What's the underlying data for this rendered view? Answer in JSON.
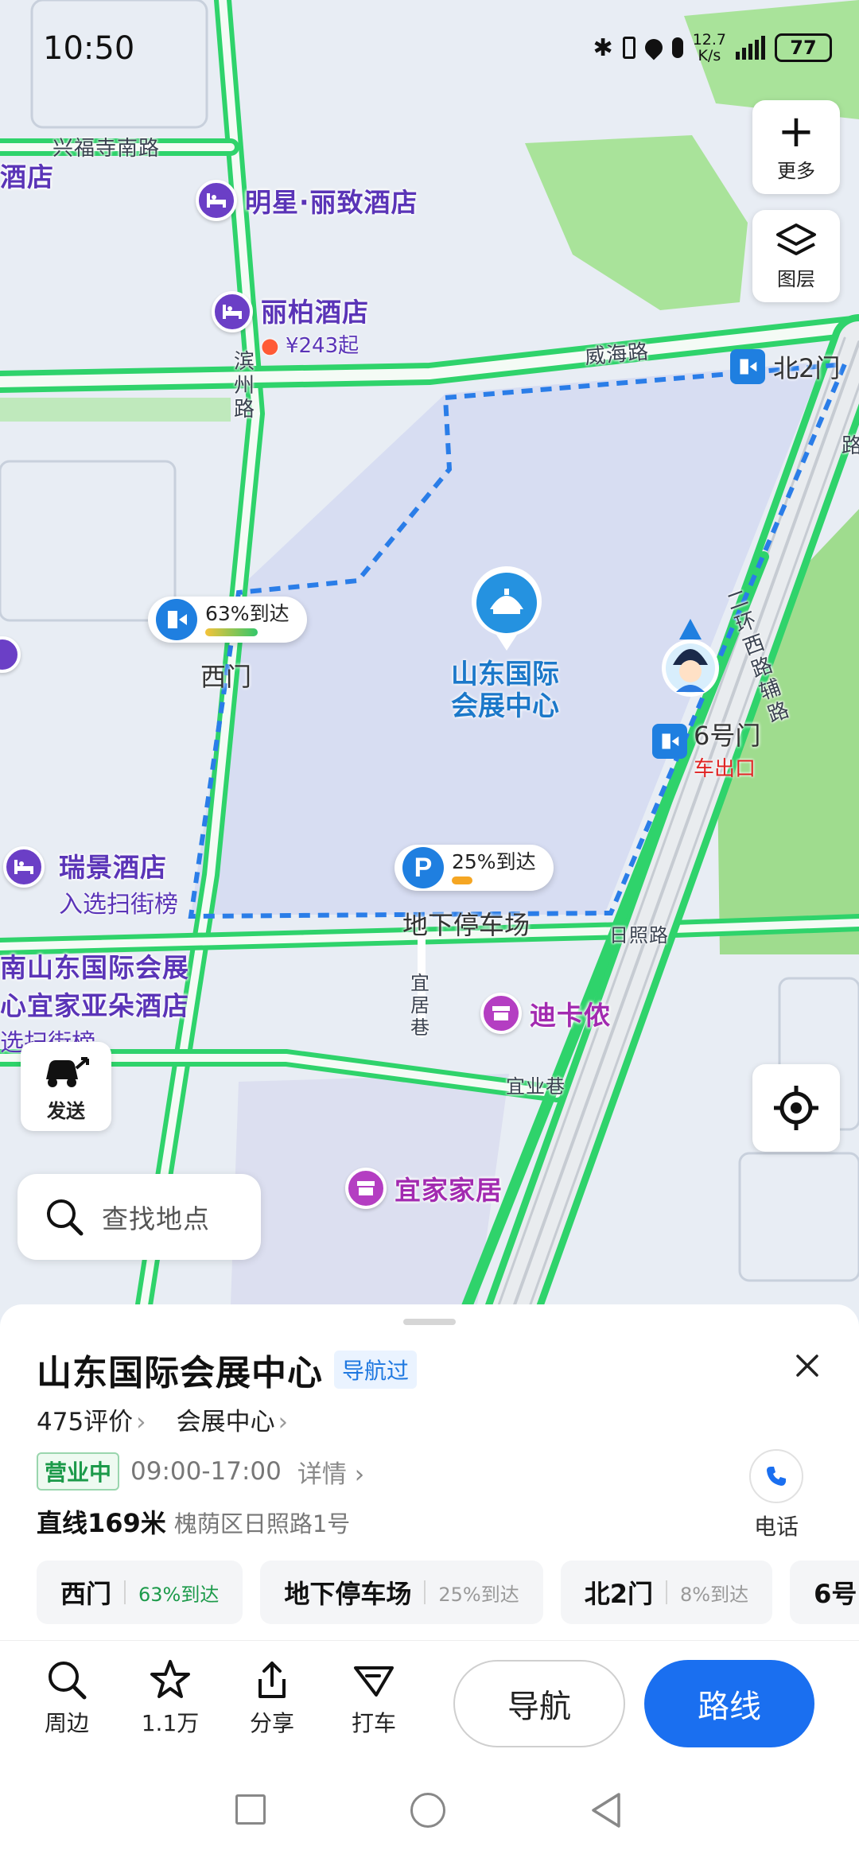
{
  "status_bar": {
    "time": "10:50",
    "net_speed_value": "12.7",
    "net_speed_unit": "K/s",
    "battery": "77"
  },
  "map": {
    "roads": {
      "xingfusi_south": "兴福寺南路",
      "weihai": "威海路",
      "binzhou": "滨州路",
      "erhuanxi": "二环西路辅路",
      "rizhao": "日照路",
      "yiju": "宜居巷",
      "yiye": "宜业巷",
      "east_cut": "路"
    },
    "pois": {
      "hotel_left_edge": "酒店",
      "mingxing": "明星·丽致酒店",
      "libai": "丽柏酒店",
      "libai_price": "¥243起",
      "ruijing": "瑞景酒店",
      "ruijing_sub": "入选扫街榜",
      "south_hotel_line1": "南山东国际会展",
      "south_hotel_line2": "心宜家亚朵酒店",
      "south_hotel_line3": "选扫街榜",
      "dikanong": "迪卡侬",
      "ikea": "宜家家居",
      "center_line1": "山东国际",
      "center_line2": "会展中心"
    },
    "gates": {
      "west": "西门",
      "west_rate": "63%到达",
      "parking": "地下停车场",
      "parking_rate": "25%到达",
      "parking_icon": "P",
      "north2": "北2门",
      "gate6": "6号门",
      "gate6_sub": "车出口"
    },
    "buttons": {
      "more": "更多",
      "layers": "图层",
      "send": "发送"
    },
    "search_placeholder": "查找地点"
  },
  "sheet": {
    "title": "山东国际会展中心",
    "tag": "导航过",
    "reviews": "475评价",
    "category": "会展中心",
    "open_status": "营业中",
    "hours": "09:00-17:00",
    "detail": "详情",
    "distance": "直线169米",
    "address": "槐荫区日照路1号",
    "phone_label": "电话",
    "chips": [
      {
        "name": "西门",
        "rate": "63%到达",
        "color": "#1c9a4a"
      },
      {
        "name": "地下停车场",
        "rate": "25%到达",
        "color": "#999999"
      },
      {
        "name": "北2门",
        "rate": "8%到达",
        "color": "#999999"
      },
      {
        "name": "6号",
        "rate": "",
        "color": "#999999"
      }
    ]
  },
  "actions": {
    "nearby": "周边",
    "favorite": "1.1万",
    "share": "分享",
    "taxi": "打车",
    "navigate": "导航",
    "route": "路线"
  },
  "colors": {
    "accent": "#1a6ff0",
    "road_green": "#2fd36b",
    "boundary": "#2a7de8",
    "poi_purple": "#5a34b7"
  }
}
